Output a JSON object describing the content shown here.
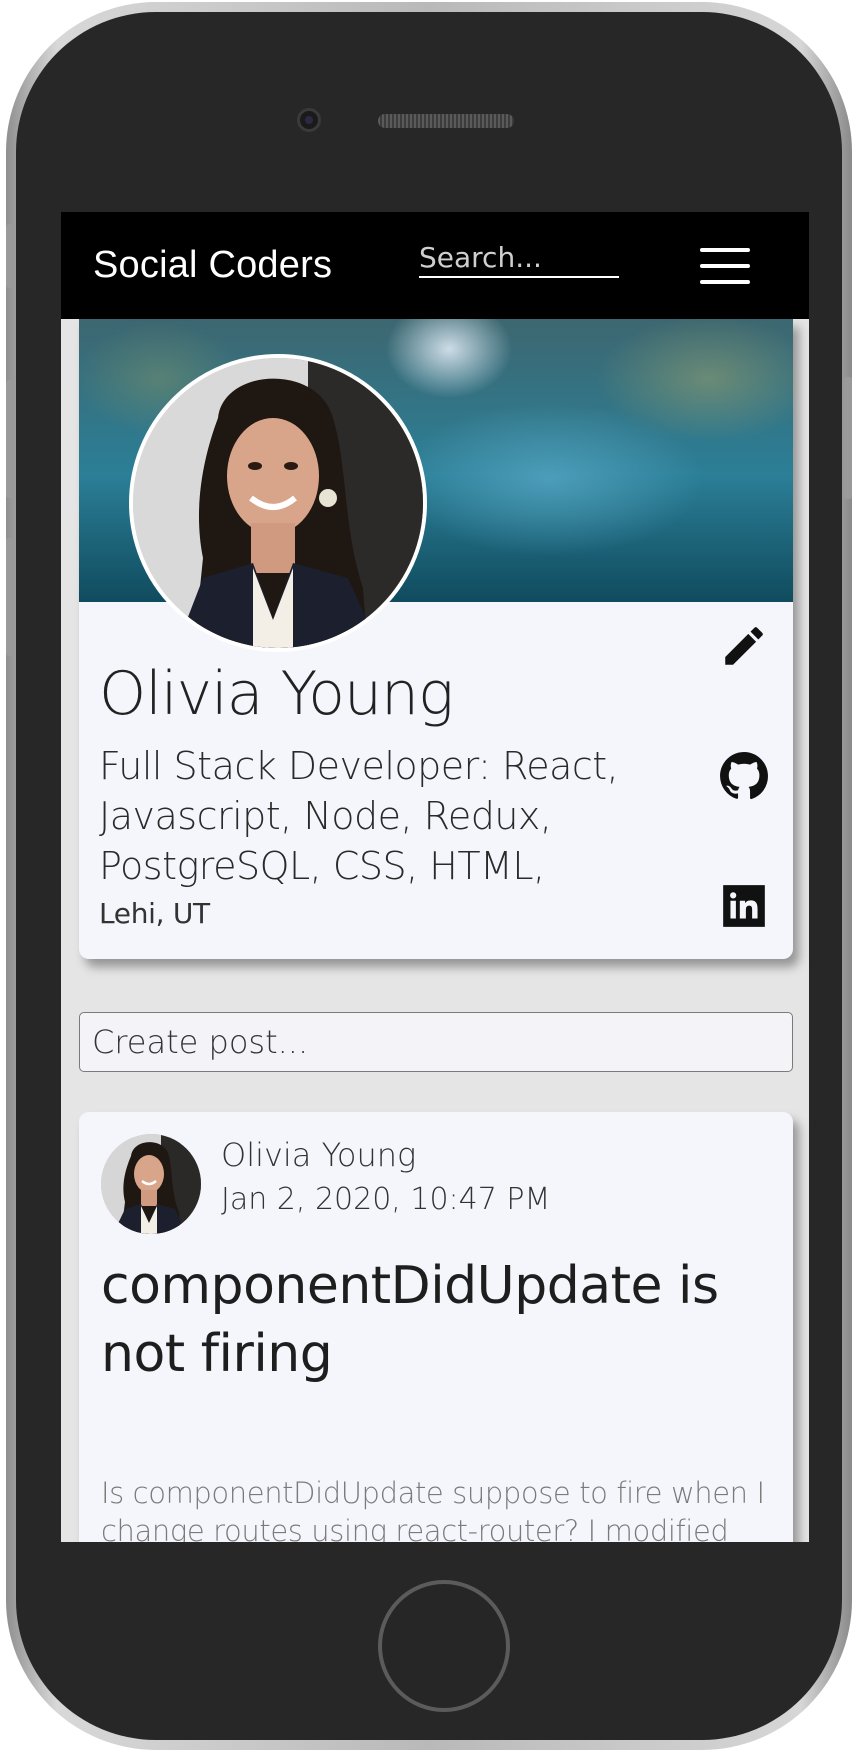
{
  "app": {
    "brand": "Social Coders"
  },
  "navbar": {
    "search_placeholder": "Search...",
    "menu_icon": "hamburger-menu-icon"
  },
  "profile": {
    "name": "Olivia Young",
    "headline": "Full Stack Developer: React, Javascript, Node, Redux, PostgreSQL, CSS, HTML,",
    "location": "Lehi, UT",
    "icons": [
      "pencil-edit-icon",
      "github-icon",
      "linkedin-icon"
    ]
  },
  "composer": {
    "placeholder": "Create post..."
  },
  "post": {
    "author": "Olivia Young",
    "timestamp": "Jan 2, 2020, 10:47 PM",
    "title": "componentDidUpdate is not firing",
    "body": "Is componentDidUpdate suppose to fire when I change routes using react-router? I modified the"
  },
  "colors": {
    "navbar_bg": "#000000",
    "card_bg": "#f5f6fb",
    "page_bg": "#e5e5e5"
  }
}
